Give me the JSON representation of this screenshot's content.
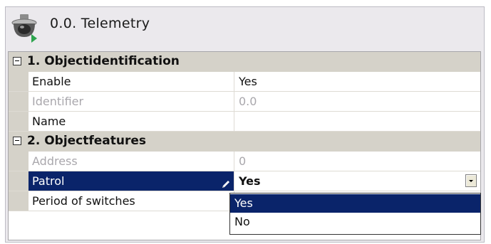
{
  "header": {
    "title": "0.0. Telemetry",
    "icon": "dome-camera-icon"
  },
  "categories": [
    {
      "label": "1. Objectidentification",
      "properties": [
        {
          "name": "Enable",
          "value": "Yes",
          "enabled": true
        },
        {
          "name": "Identifier",
          "value": "0.0",
          "enabled": false
        },
        {
          "name": "Name",
          "value": "",
          "enabled": true
        }
      ]
    },
    {
      "label": "2. Objectfeatures",
      "properties": [
        {
          "name": "Address",
          "value": "0",
          "enabled": false
        },
        {
          "name": "Patrol",
          "value": "Yes",
          "enabled": true,
          "selected": true
        },
        {
          "name": "Period of switches",
          "value": "",
          "enabled": true
        }
      ]
    }
  ],
  "dropdown": {
    "options": [
      "Yes",
      "No"
    ],
    "highlighted": "Yes"
  },
  "colors": {
    "selection": "#0a246a",
    "category_bg": "#d5d2c9",
    "panel_bg": "#ebe9ed"
  }
}
